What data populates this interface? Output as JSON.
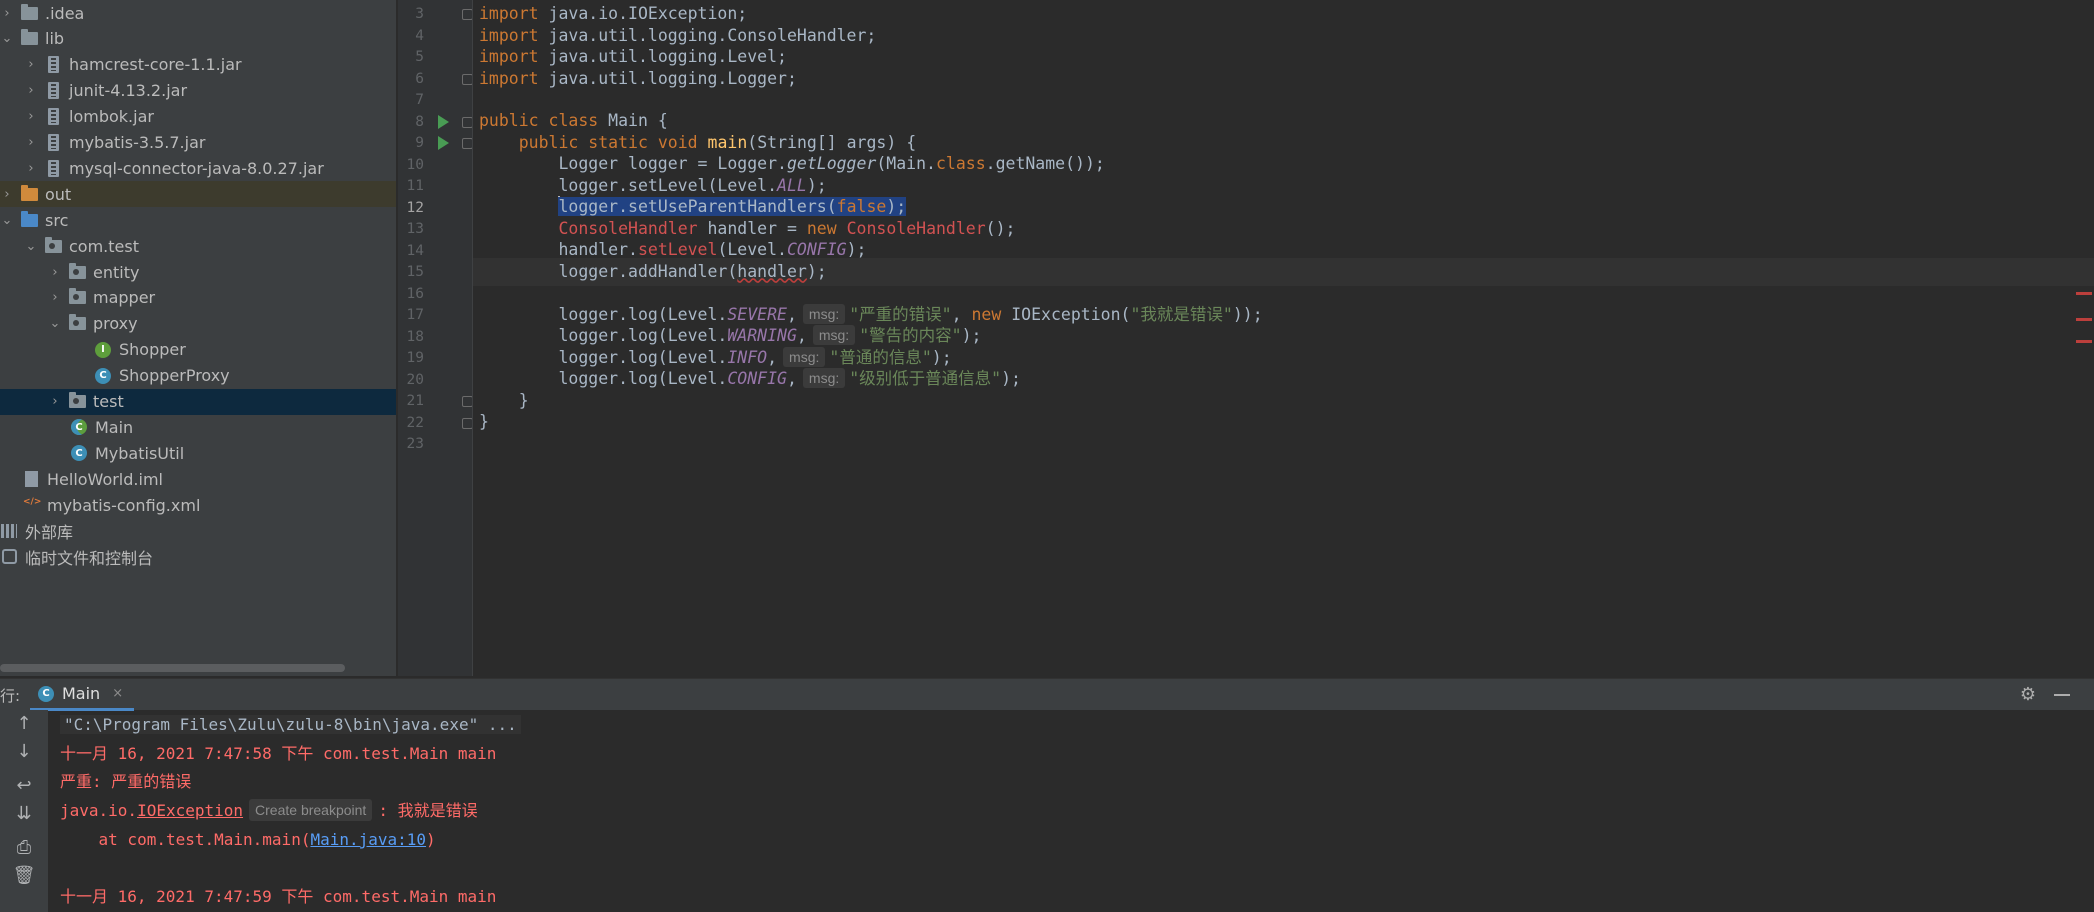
{
  "project_tree": {
    "items": [
      {
        "label": ".idea",
        "icon": "folder-icon",
        "chevron": "›",
        "kind": "folder"
      },
      {
        "label": "lib",
        "icon": "folder-icon",
        "chevron": "⌄",
        "kind": "folder"
      },
      {
        "label": "hamcrest-core-1.1.jar",
        "icon": "jar-icon",
        "chevron": "›",
        "kind": "jar"
      },
      {
        "label": "junit-4.13.2.jar",
        "icon": "jar-icon",
        "chevron": "›",
        "kind": "jar"
      },
      {
        "label": "lombok.jar",
        "icon": "jar-icon",
        "chevron": "›",
        "kind": "jar"
      },
      {
        "label": "mybatis-3.5.7.jar",
        "icon": "jar-icon",
        "chevron": "›",
        "kind": "jar"
      },
      {
        "label": "mysql-connector-java-8.0.27.jar",
        "icon": "jar-icon",
        "chevron": "›",
        "kind": "jar"
      },
      {
        "label": "out",
        "icon": "folder-icon",
        "chevron": "›",
        "kind": "folder-orange"
      },
      {
        "label": "src",
        "icon": "folder-icon",
        "chevron": "⌄",
        "kind": "folder-blue"
      },
      {
        "label": "com.test",
        "icon": "package-icon",
        "chevron": "⌄",
        "kind": "package"
      },
      {
        "label": "entity",
        "icon": "package-icon",
        "chevron": "›",
        "kind": "package"
      },
      {
        "label": "mapper",
        "icon": "package-icon",
        "chevron": "›",
        "kind": "package"
      },
      {
        "label": "proxy",
        "icon": "package-icon",
        "chevron": "⌄",
        "kind": "package"
      },
      {
        "label": "Shopper",
        "icon": "interface-icon",
        "chevron": "",
        "kind": "interface"
      },
      {
        "label": "ShopperProxy",
        "icon": "class-icon",
        "chevron": "",
        "kind": "class"
      },
      {
        "label": "test",
        "icon": "package-icon",
        "chevron": "›",
        "kind": "package"
      },
      {
        "label": "Main",
        "icon": "class-icon",
        "chevron": "",
        "kind": "class-main"
      },
      {
        "label": "MybatisUtil",
        "icon": "class-icon",
        "chevron": "",
        "kind": "class"
      },
      {
        "label": "HelloWorld.iml",
        "icon": "iml-file-icon",
        "chevron": "",
        "kind": "iml"
      },
      {
        "label": "mybatis-config.xml",
        "icon": "xml-file-icon",
        "chevron": "",
        "kind": "xml"
      },
      {
        "label": "外部库",
        "icon": "library-icon",
        "chevron": "",
        "kind": "lib"
      },
      {
        "label": "临时文件和控制台",
        "icon": "scratch-icon",
        "chevron": "",
        "kind": "scratch"
      }
    ]
  },
  "editor": {
    "line_numbers": [
      "3",
      "4",
      "5",
      "6",
      "7",
      "8",
      "9",
      "10",
      "11",
      "12",
      "13",
      "14",
      "15",
      "16",
      "17",
      "18",
      "19",
      "20",
      "21",
      "22",
      "23"
    ],
    "current_line": "12",
    "code": {
      "l3_kw": "import",
      "l3_rest": " java.io.IOException;",
      "l4_kw": "import",
      "l4_rest": " java.util.logging.ConsoleHandler;",
      "l5_kw": "import",
      "l5_rest": " java.util.logging.Level;",
      "l6_kw": "import",
      "l6_rest": " java.util.logging.Logger;",
      "l8_kw1": "public",
      "l8_kw2": "class",
      "l8_name": " Main {",
      "l9_indent": "    ",
      "l9_kw1": "public",
      "l9_kw2": "static",
      "l9_kw3": "void",
      "l9_fn": "main",
      "l9_rest": "(String[] args) {",
      "l10_a": "        Logger logger = Logger.",
      "l10_it": "getLogger",
      "l10_b": "(Main.",
      "l10_kw": "class",
      "l10_c": ".getName());",
      "l11_a": "        logger.setLevel(Level.",
      "l11_const": "ALL",
      "l11_b": ");",
      "l12_indent": "        ",
      "l12_a": "logger.setUseParentHandlers(",
      "l12_kw": "false",
      "l12_b": ");",
      "l13_indent": "        ",
      "l13_type": "ConsoleHandler",
      "l13_mid": " handler = ",
      "l13_kw": "new",
      "l13_type2": "ConsoleHandler",
      "l13_end": "();",
      "l14_a": "        handler.",
      "l14_fn": "setLevel",
      "l14_b": "(Level.",
      "l14_const": "CONFIG",
      "l14_c": ");",
      "l15_a": "        logger.addHandler(",
      "l15_arg": "handler",
      "l15_b": ");",
      "l17_a": "        logger.log(Level.",
      "l17_const": "SEVERE",
      "l17_b": ",",
      "l17_hint": "msg:",
      "l17_str": "\"严重的错误\"",
      "l17_c": ", ",
      "l17_kw": "new",
      "l17_d": " IOException(",
      "l17_str2": "\"我就是错误\"",
      "l17_e": "));",
      "l18_a": "        logger.log(Level.",
      "l18_const": "WARNING",
      "l18_b": ",",
      "l18_hint": "msg:",
      "l18_str": "\"警告的内容\"",
      "l18_c": ");",
      "l19_a": "        logger.log(Level.",
      "l19_const": "INFO",
      "l19_b": ",",
      "l19_hint": "msg:",
      "l19_str": "\"普通的信息\"",
      "l19_c": ");",
      "l20_a": "        logger.log(Level.",
      "l20_const": "CONFIG",
      "l20_b": ",",
      "l20_hint": "msg:",
      "l20_str": "\"级别低于普通信息\"",
      "l20_c": ");",
      "l21": "    }",
      "l22": "}"
    }
  },
  "run_panel": {
    "prefix": "行:",
    "tab_label": "Main",
    "tab_close": "×",
    "console": {
      "cmd": "\"C:\\Program Files\\Zulu\\zulu-8\\bin\\java.exe\" ...",
      "log1": "十一月 16, 2021 7:47:58 下午 com.test.Main main",
      "log2": "严重: 严重的错误",
      "exc_prefix": "java.io.",
      "exc_class": "IOException",
      "bp_hint": "Create breakpoint",
      "exc_msg": ": 我就是错误",
      "at_prefix": "    at com.test.Main.main(",
      "at_link": "Main.java:10",
      "at_suffix": ")",
      "log3": "十一月 16, 2021 7:47:59 下午 com.test.Main main"
    }
  },
  "colors": {
    "accent": "#4a88c7",
    "run_green": "#499c54",
    "error_red": "#ff6b68",
    "keyword": "#cc7832",
    "string": "#6a8759",
    "constant": "#9876aa"
  }
}
